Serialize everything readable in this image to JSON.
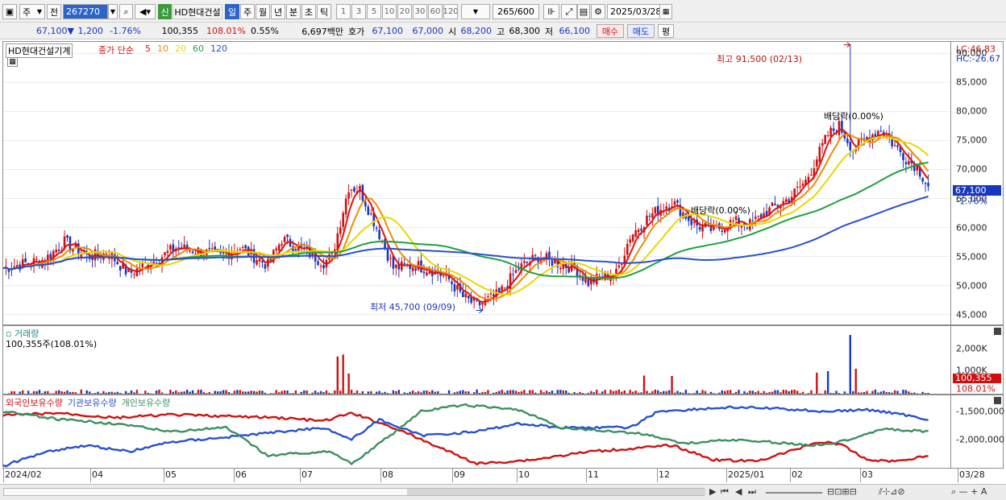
{
  "toolbar": {
    "period_type": "주",
    "prev_label": "전",
    "stock_code": "267270",
    "new_label": "신",
    "stock_name": "HD현대건설",
    "period_buttons": [
      "일",
      "주",
      "월",
      "년",
      "분",
      "초",
      "틱"
    ],
    "interval_buttons": [
      "1",
      "3",
      "5",
      "10",
      "20",
      "30",
      "60",
      "120"
    ],
    "count_label": "265/600",
    "date": "2025/03/28"
  },
  "quote": {
    "price": "67,100▼",
    "change": "1,200",
    "change_pct": "-1.76%",
    "volume": "100,355",
    "volume_ratio": "108.01%",
    "turnover": "0.55%",
    "amount": "6,697백만",
    "bid_label": "호가",
    "bid": "67,100",
    "ask": "67,000",
    "open_label": "시",
    "open": "68,200",
    "high_label": "고",
    "high": "68,300",
    "low_label": "저",
    "low": "66,100",
    "buy_label": "매수",
    "sell_label": "매도",
    "avg_label": "평"
  },
  "price_panel": {
    "title": "HD현대건설기계",
    "ma_label": "종가 단순",
    "ma_periods": [
      {
        "v": "5",
        "c": "#e01010"
      },
      {
        "v": "10",
        "c": "#f08c00"
      },
      {
        "v": "20",
        "c": "#e8d800"
      },
      {
        "v": "60",
        "c": "#20a040"
      },
      {
        "v": "120",
        "c": "#2850d0"
      }
    ],
    "lc": "LC:46.83",
    "hc": "HC:-26.67",
    "y_ticks": [
      "90,000",
      "85,000",
      "80,000",
      "75,000",
      "70,000",
      "65,000",
      "60,000",
      "55,000",
      "50,000",
      "45,000"
    ],
    "current_price": "67,100",
    "current_pct": "-1.76%",
    "high_annotation": "최고 91,500 (02/13)",
    "low_annotation": "최저 45,700 (09/09)",
    "dividend_1": "배당락(0.00%)",
    "dividend_2": "배당락(0.00%)"
  },
  "volume_panel": {
    "title": "거래량",
    "value": "100,355주(108.01%)",
    "y_ticks": [
      "2,000K",
      "1,000K"
    ],
    "current_volume": "100,355",
    "current_pct": "108.01%"
  },
  "holdings_panel": {
    "legend": [
      {
        "v": "외국인보유수량",
        "c": "#d01010"
      },
      {
        "v": "기관보유수량",
        "c": "#2850d0"
      },
      {
        "v": "개인보유수량",
        "c": "#3a9060"
      }
    ],
    "y_ticks": [
      "-1,500,000",
      "-2,000,000"
    ]
  },
  "x_axis": [
    "2024/02",
    "04",
    "05",
    "06",
    "07",
    "08",
    "09",
    "10",
    "11",
    "12",
    "2025/01",
    "02",
    "03",
    "03/28"
  ],
  "chart_data": {
    "type": "candlestick",
    "x_labels": [
      "2024/02",
      "04",
      "05",
      "06",
      "07",
      "08",
      "09",
      "10",
      "11",
      "12",
      "2025/01",
      "02",
      "03",
      "03/28"
    ],
    "y_range": [
      43000,
      92000
    ],
    "close_approx": [
      {
        "t": "2024/02",
        "v": 53000
      },
      {
        "t": "04",
        "v": 57000
      },
      {
        "t": "05",
        "v": 53000
      },
      {
        "t": "06",
        "v": 57000
      },
      {
        "t": "07",
        "v": 54000
      },
      {
        "t": "07 late",
        "v": 69000
      },
      {
        "t": "08",
        "v": 52000
      },
      {
        "t": "09",
        "v": 46500
      },
      {
        "t": "10",
        "v": 54000
      },
      {
        "t": "11",
        "v": 50000
      },
      {
        "t": "11 late",
        "v": 64000
      },
      {
        "t": "12",
        "v": 61000
      },
      {
        "t": "2025/01",
        "v": 67000
      },
      {
        "t": "02",
        "v": 78000
      },
      {
        "t": "03",
        "v": 75000
      },
      {
        "t": "03/28",
        "v": 67100
      }
    ],
    "high": {
      "value": 91500,
      "date": "02/13"
    },
    "low": {
      "value": 45700,
      "date": "09/09"
    }
  }
}
